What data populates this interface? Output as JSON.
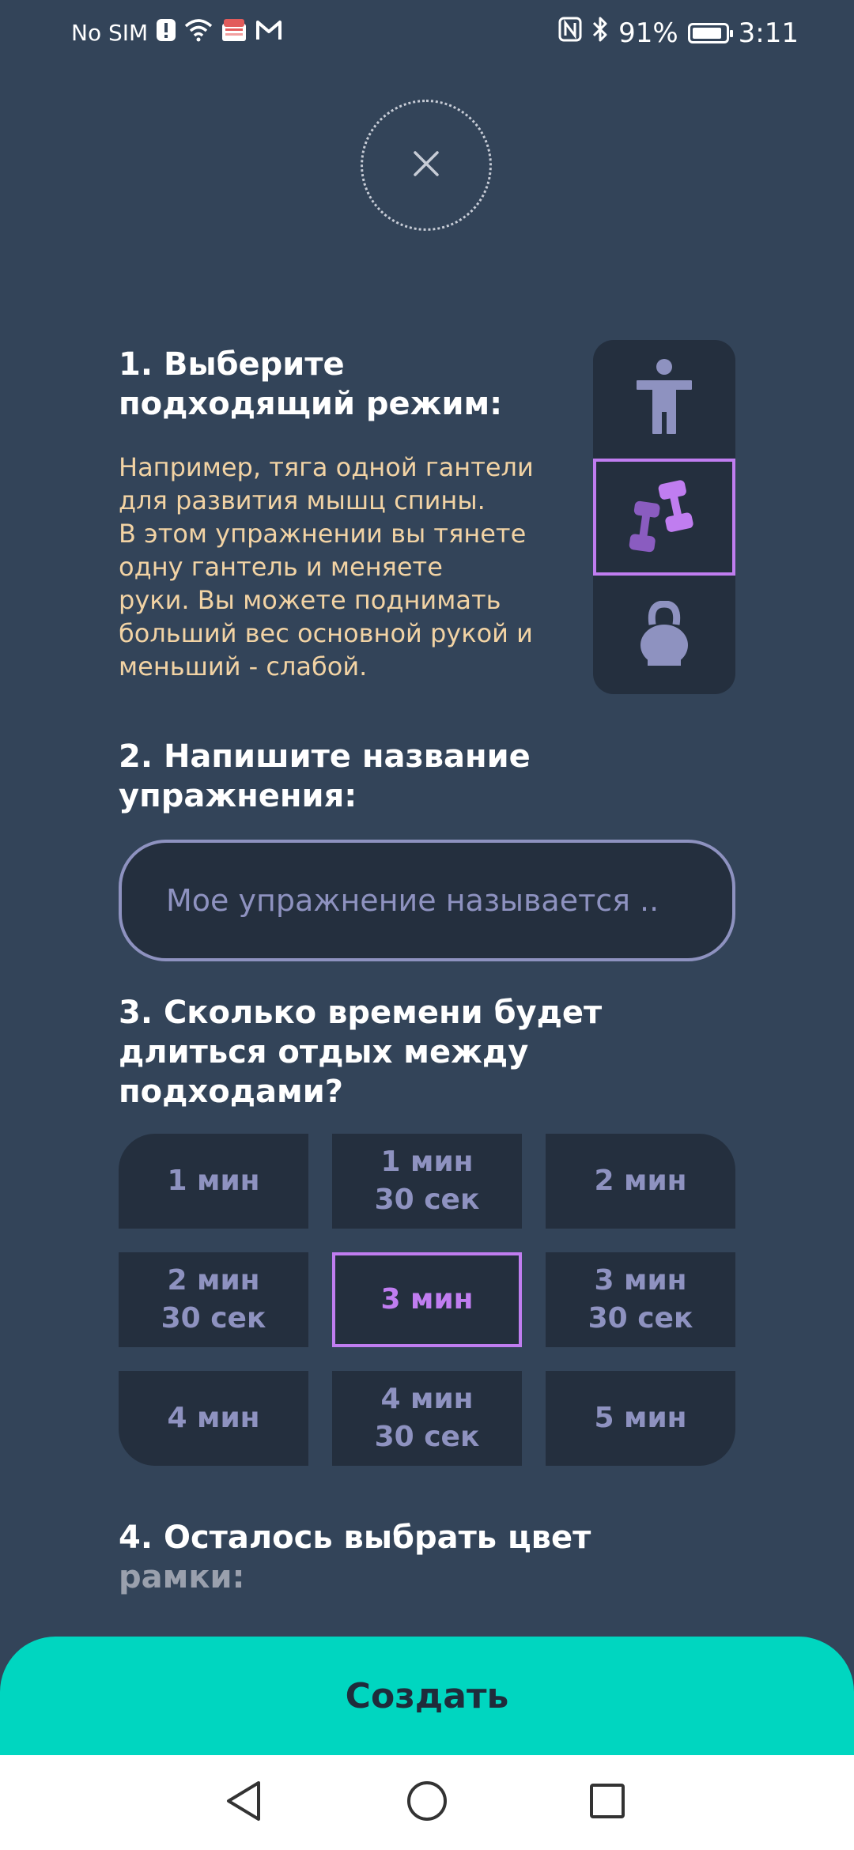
{
  "status_bar": {
    "carrier": "No SIM",
    "battery": "91%",
    "battery_level": 0.91,
    "time": "3:11",
    "left_icons": [
      "alert-icon",
      "wifi-icon",
      "app-notification-icon",
      "gmail-icon"
    ],
    "right_icons": [
      "nfc-icon",
      "bluetooth-icon",
      "battery-icon"
    ]
  },
  "close": {
    "icon": "close-icon"
  },
  "section1": {
    "title": "1. Выберите подходящий режим:",
    "description": "Например, тяга одной гантели\nдля  развития мышц спины.\nВ этом упражнении вы тянете\nодну гантель и меняете\nруки. Вы можете поднимать\nбольший вес основной рукой и\nменьший - слабой.",
    "modes": [
      {
        "icon": "bodyweight-icon",
        "selected": false
      },
      {
        "icon": "dumbbells-icon",
        "selected": true
      },
      {
        "icon": "kettlebell-icon",
        "selected": false
      }
    ]
  },
  "section2": {
    "title": "2. Напишите название упражнения:",
    "placeholder": "Мое упражнение называется .."
  },
  "section3": {
    "title": "3. Сколько времени будет длиться отдых между подходами?",
    "options": [
      {
        "label": "1 мин",
        "selected": false
      },
      {
        "label": "1 мин\n30 сек",
        "selected": false
      },
      {
        "label": "2 мин",
        "selected": false
      },
      {
        "label": "2 мин\n30 сек",
        "selected": false
      },
      {
        "label": "3 мин",
        "selected": true
      },
      {
        "label": "3 мин\n30 сек",
        "selected": false
      },
      {
        "label": "4 мин",
        "selected": false
      },
      {
        "label": "4 мин\n30 сек",
        "selected": false
      },
      {
        "label": "5 мин",
        "selected": false
      }
    ]
  },
  "section4": {
    "title_line1": "4. Осталось выбрать цвет",
    "title_line2": "рамки:"
  },
  "create_button": "Создать",
  "colors": {
    "background": "#334459",
    "panel": "#242f3e",
    "accent_purple": "#c07df0",
    "muted_purple": "#8e92c0",
    "description_text": "#f2d3a4",
    "create_button": "#00d6c0"
  },
  "nav": {
    "back": "back-icon",
    "home": "home-icon",
    "recents": "recents-icon"
  }
}
